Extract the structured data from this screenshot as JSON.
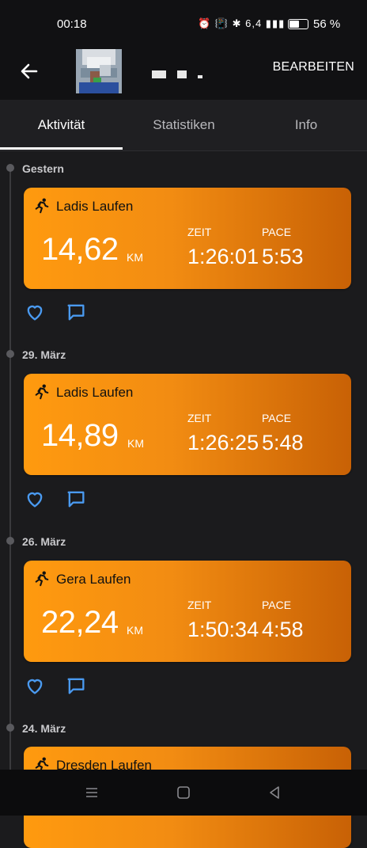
{
  "status_bar": {
    "time": "00:18",
    "icons_text": "⏰ 📳 ✱ 6,4 ▮▮▮",
    "battery_percent": 56,
    "battery_text": "56 %"
  },
  "header": {
    "edit_label": "BEARBEITEN"
  },
  "tabs": [
    {
      "label": "Aktivität",
      "active": true
    },
    {
      "label": "Statistiken",
      "active": false
    },
    {
      "label": "Info",
      "active": false
    }
  ],
  "activities": [
    {
      "date": "Gestern",
      "title": "Ladis Laufen",
      "distance": "14,62",
      "unit": "KM",
      "time_label": "ZEIT",
      "time": "1:26:01",
      "pace_label": "PACE",
      "pace": "5:53"
    },
    {
      "date": "29. März",
      "title": "Ladis Laufen",
      "distance": "14,89",
      "unit": "KM",
      "time_label": "ZEIT",
      "time": "1:26:25",
      "pace_label": "PACE",
      "pace": "5:48"
    },
    {
      "date": "26. März",
      "title": "Gera Laufen",
      "distance": "22,24",
      "unit": "KM",
      "time_label": "ZEIT",
      "time": "1:50:34",
      "pace_label": "PACE",
      "pace": "4:58"
    },
    {
      "date": "24. März",
      "title": "Dresden Laufen"
    }
  ],
  "colors": {
    "card_orange_light": "#ff9a0f",
    "card_orange_dark": "#c86105",
    "action_blue": "#4a9af0",
    "background": "#1b1b1d"
  }
}
